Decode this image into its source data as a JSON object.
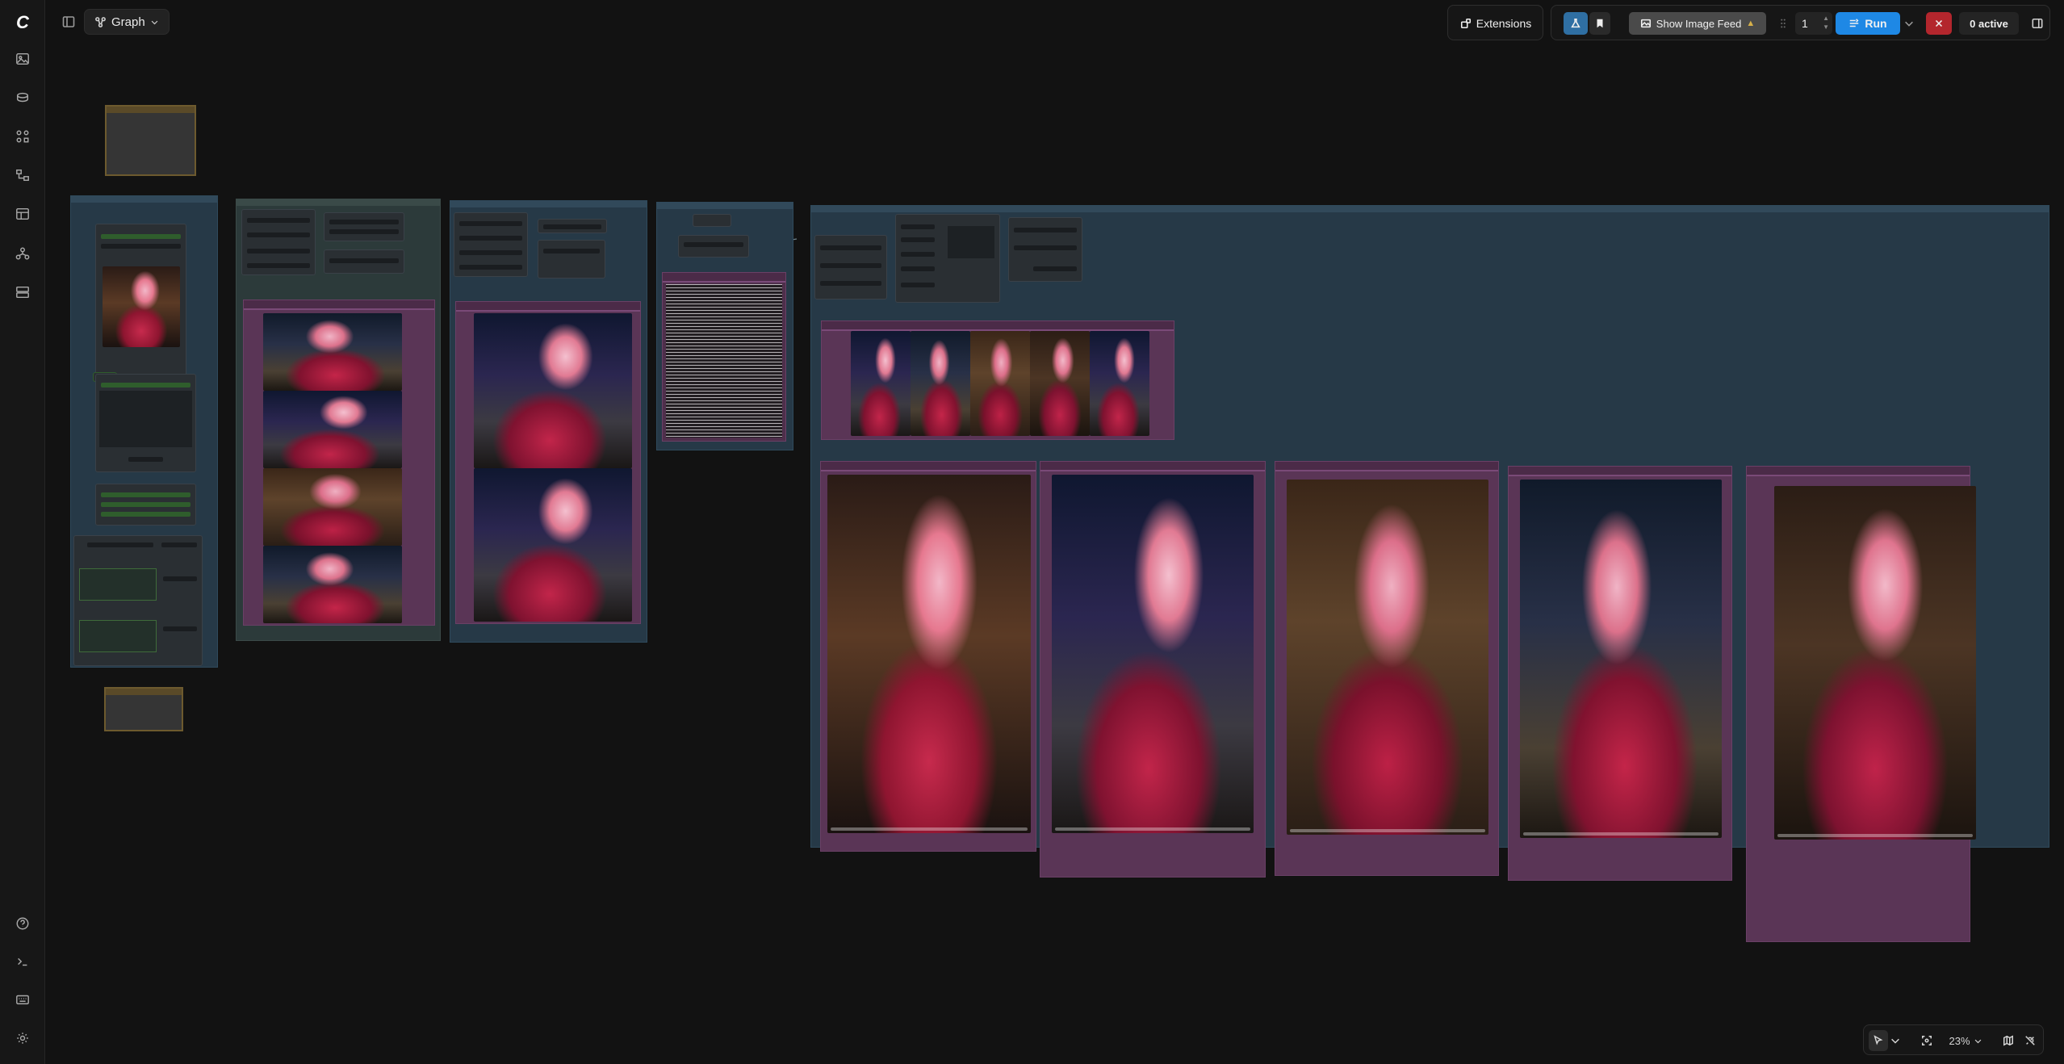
{
  "header": {
    "workflow_tab_label": "Graph"
  },
  "toolbar": {
    "extensions_label": "Extensions",
    "show_image_feed_label": "Show Image Feed",
    "run_count": "1",
    "run_label": "Run",
    "active_label": "0 active"
  },
  "zoom": {
    "level": "23%"
  },
  "icons": {
    "rail_top": [
      "images-icon",
      "models-icon",
      "nodes-icon",
      "workflows-icon",
      "templates-icon",
      "queue-icon",
      "manager-icon"
    ],
    "rail_bottom": [
      "help-icon",
      "terminal-icon",
      "keyboard-icon",
      "settings-icon"
    ]
  },
  "colors": {
    "run_button": "#1e88e5",
    "cancel_button": "#b3262d",
    "group_blue": "#263947",
    "image_node": "#5a3556"
  }
}
